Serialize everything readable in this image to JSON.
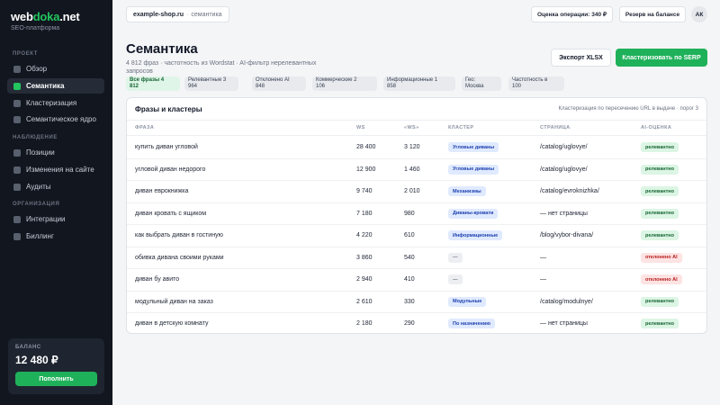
{
  "sidebar": {
    "logo": {
      "part1": "web",
      "part2": "doka",
      "part3": ".net"
    },
    "subtitle": "SEO-платформа",
    "sections": [
      "ПРОЕКТ",
      "НАБЛЮДЕНИЕ",
      "ОРГАНИЗАЦИЯ"
    ],
    "items": [
      {
        "label": "Обзор"
      },
      {
        "label": "Семантика"
      },
      {
        "label": "Кластеризация"
      },
      {
        "label": "Семантическое ядро"
      },
      {
        "label": "Позиции"
      },
      {
        "label": "Изменения на сайте"
      },
      {
        "label": "Аудиты"
      },
      {
        "label": "Интеграции"
      },
      {
        "label": "Биллинг"
      }
    ],
    "balance": {
      "label": "БАЛАНС",
      "value": "12 480 ₽",
      "button": "Пополнить"
    }
  },
  "topbar": {
    "site": "example-shop.ru",
    "separator": "·",
    "crumb": "семантика",
    "cost": "Оценка операции: 340 ₽",
    "reserve": "Резерв на балансе",
    "avatar": "АК"
  },
  "header": {
    "title": "Семантика",
    "subtitle": "4 812 фраз · частотность из Wordstat · AI-фильтр нерелевантных запросов",
    "export_button": "Экспорт XLSX",
    "cluster_button": "Кластеризовать по SERP"
  },
  "filters": [
    {
      "line1": "Все фразы 4",
      "line2": "812"
    },
    {
      "line1": "Релевантные 3",
      "line2": "964"
    },
    {
      "line1": "Отклонено AI",
      "line2": "848"
    },
    {
      "line1": "Коммерческие 2",
      "line2": "106"
    },
    {
      "line1": "Информационные 1",
      "line2": "858"
    },
    {
      "line1": "Гео:",
      "line2": "Москва"
    },
    {
      "line1": "Частотность в",
      "line2": "100"
    }
  ],
  "table": {
    "title": "Фразы и кластеры",
    "note": "Кластеризация по пересечению URL в выдаче · порог 3",
    "columns": {
      "phrase": "ФРАЗА",
      "ws": "WS",
      "ws_exact": "«WS»",
      "cluster": "КЛАСТЕР",
      "page": "СТРАНИЦА",
      "ai": "AI-ОЦЕНКА"
    },
    "rows": [
      {
        "phrase": "купить диван угловой",
        "ws": "28 400",
        "ws_exact": "3 120",
        "cluster": "Угловые диваны",
        "page": "/catalog/uglovye/",
        "ai": "релевантно"
      },
      {
        "phrase": "угловой диван недорого",
        "ws": "12 900",
        "ws_exact": "1 460",
        "cluster": "Угловые диваны",
        "page": "/catalog/uglovye/",
        "ai": "релевантно"
      },
      {
        "phrase": "диван еврокнижка",
        "ws": "9 740",
        "ws_exact": "2 010",
        "cluster": "Механизмы",
        "page": "/catalog/evroknizhka/",
        "ai": "релевантно"
      },
      {
        "phrase": "диван кровать с ящиком",
        "ws": "7 180",
        "ws_exact": "980",
        "cluster": "Диваны-кровати",
        "page": "— нет страницы",
        "ai": "релевантно"
      },
      {
        "phrase": "как выбрать диван в гостиную",
        "ws": "4 220",
        "ws_exact": "610",
        "cluster": "Информационные",
        "page": "/blog/vybor-divana/",
        "ai": "релевантно"
      },
      {
        "phrase": "обивка дивана своими руками",
        "ws": "3 860",
        "ws_exact": "540",
        "cluster": "—",
        "page": "—",
        "ai": "отклонено AI"
      },
      {
        "phrase": "диван бу авито",
        "ws": "2 940",
        "ws_exact": "410",
        "cluster": "—",
        "page": "—",
        "ai": "отклонено AI"
      },
      {
        "phrase": "модульный диван на заказ",
        "ws": "2 610",
        "ws_exact": "330",
        "cluster": "Модульные",
        "page": "/catalog/modulnye/",
        "ai": "релевантно"
      },
      {
        "phrase": "диван в детскую комнату",
        "ws": "2 180",
        "ws_exact": "290",
        "cluster": "По назначению",
        "page": "— нет страницы",
        "ai": "релевантно"
      }
    ]
  },
  "colors": {
    "accent": "#1fb15a",
    "sidebar_bg": "#11161f",
    "relevant": "#166534",
    "rejected": "#b91c1c",
    "cluster": "#1e40af"
  }
}
